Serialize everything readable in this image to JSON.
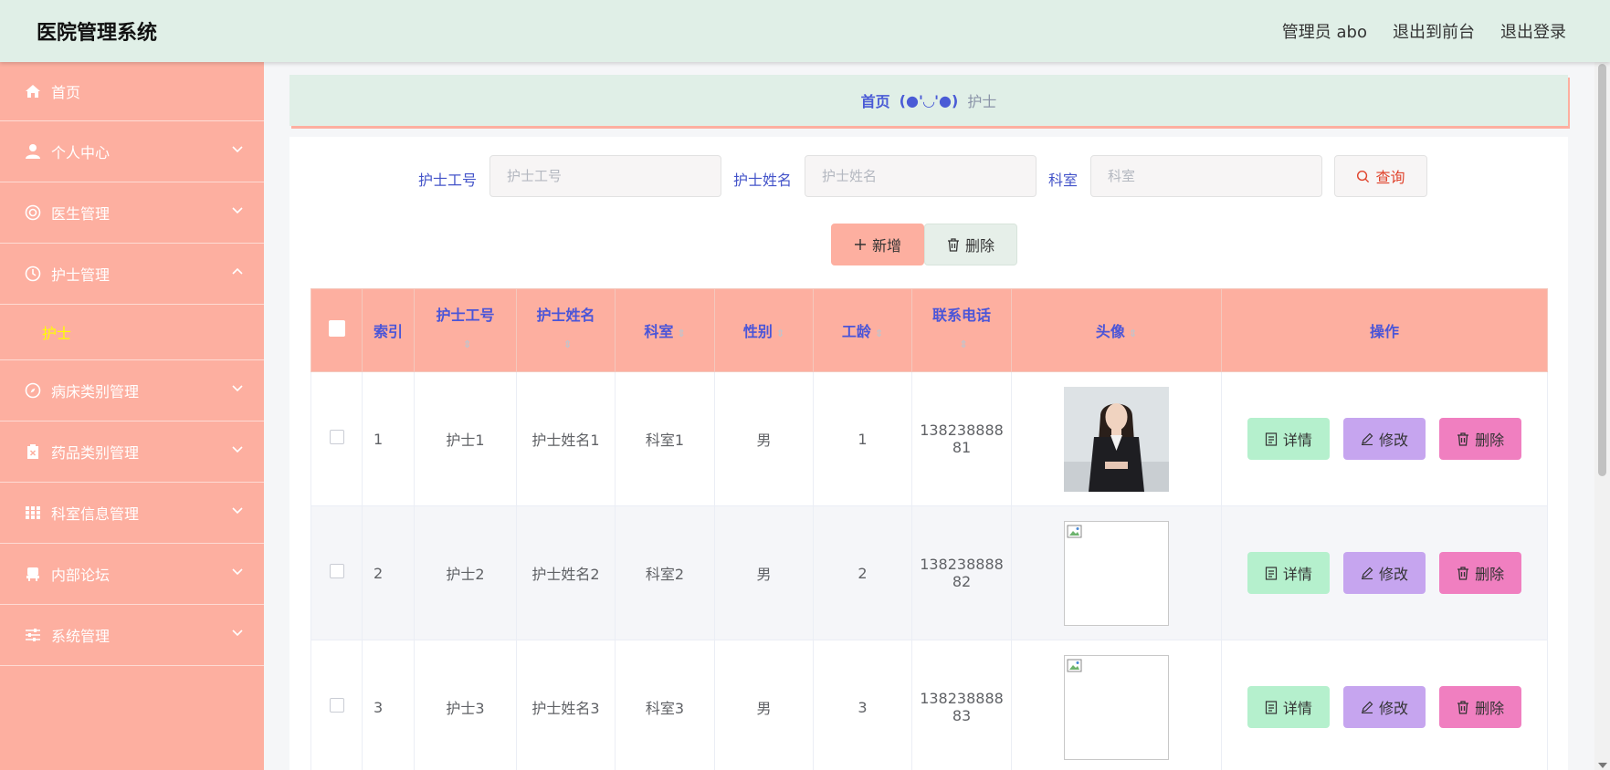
{
  "header": {
    "app_title": "医院管理系统",
    "admin_label": "管理员 abo",
    "to_front": "退出到前台",
    "logout": "退出登录"
  },
  "sidebar": {
    "items": [
      {
        "label": "首页",
        "icon": "home-icon"
      },
      {
        "label": "个人中心",
        "icon": "user-icon"
      },
      {
        "label": "医生管理",
        "icon": "lifebuoy-icon"
      },
      {
        "label": "护士管理",
        "icon": "clock-icon",
        "expanded": true,
        "children": [
          {
            "label": "护士"
          }
        ]
      },
      {
        "label": "病床类别管理",
        "icon": "compass-icon"
      },
      {
        "label": "药品类别管理",
        "icon": "clipboard-icon"
      },
      {
        "label": "科室信息管理",
        "icon": "grid-icon"
      },
      {
        "label": "内部论坛",
        "icon": "chair-icon"
      },
      {
        "label": "系统管理",
        "icon": "sliders-icon"
      }
    ]
  },
  "breadcrumb": {
    "home": "首页",
    "separator": "(●'◡'●)",
    "current": "护士"
  },
  "search": {
    "fields": [
      {
        "label": "护士工号",
        "placeholder": "护士工号"
      },
      {
        "label": "护士姓名",
        "placeholder": "护士姓名"
      },
      {
        "label": "科室",
        "placeholder": "科室"
      }
    ],
    "query_label": "查询"
  },
  "actions": {
    "add_label": "新增",
    "delete_label": "删除"
  },
  "table": {
    "columns": [
      "索引",
      "护士工号",
      "护士姓名",
      "科室",
      "性别",
      "工龄",
      "联系电话",
      "头像",
      "操作"
    ],
    "rows": [
      {
        "index": "1",
        "no": "护士1",
        "name": "护士姓名1",
        "dept": "科室1",
        "gender": "男",
        "years": "1",
        "phone_a": "138238888",
        "phone_b": "81",
        "avatar": "photo"
      },
      {
        "index": "2",
        "no": "护士2",
        "name": "护士姓名2",
        "dept": "科室2",
        "gender": "男",
        "years": "2",
        "phone_a": "138238888",
        "phone_b": "82",
        "avatar": "broken"
      },
      {
        "index": "3",
        "no": "护士3",
        "name": "护士姓名3",
        "dept": "科室3",
        "gender": "男",
        "years": "3",
        "phone_a": "138238888",
        "phone_b": "83",
        "avatar": "broken"
      }
    ],
    "row_actions": {
      "detail": "详情",
      "edit": "修改",
      "delete": "删除"
    }
  },
  "colors": {
    "sidebar_bg": "#fdafa0",
    "header_bg": "#e0efe7",
    "table_header_bg": "#fdafa0",
    "table_header_text": "#4a55d8",
    "active_submenu": "#ffff00",
    "detail_btn": "#b5f0cd",
    "edit_btn": "#c6a5ef",
    "delete_btn": "#f07fc0"
  }
}
